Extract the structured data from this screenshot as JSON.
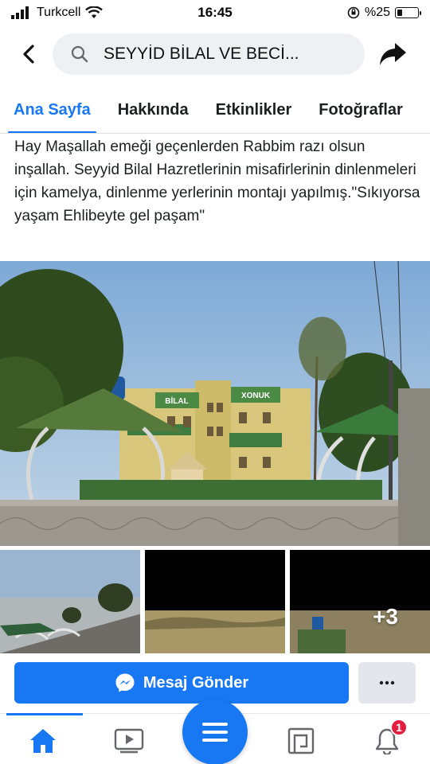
{
  "status": {
    "carrier": "Turkcell",
    "time": "16:45",
    "battery_text": "%25",
    "battery_level": 0.25
  },
  "header": {
    "search_text": "SEYYİD BİLAL VE BECİ..."
  },
  "tabs": [
    {
      "label": "Ana Sayfa",
      "active": true
    },
    {
      "label": "Hakkında"
    },
    {
      "label": "Etkinlikler"
    },
    {
      "label": "Fotoğraflar"
    }
  ],
  "post": {
    "text": "Hay Maşallah emeği geçenlerden Rabbim razı olsun inşallah. Seyyid Bilal Hazretlerinin misafirlerinin dinlenmeleri için kamelya, dinlenme yerlerinin montajı yapılmış.\"Sıkıyorsa yaşam Ehlibeyte gel paşam\""
  },
  "photo": {
    "sign_left": "BİLAL",
    "sign_right": "XONUK"
  },
  "thumbs": {
    "more_count": "+3"
  },
  "actions": {
    "message_label": "Mesaj Gönder"
  },
  "nav": {
    "notification_count": "1"
  },
  "colors": {
    "accent": "#1877f2",
    "badge": "#e41e3f"
  }
}
